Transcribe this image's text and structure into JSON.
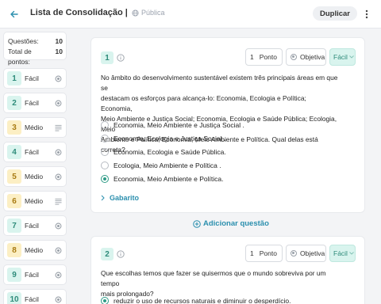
{
  "header": {
    "title": "Lista de Consolidação | Con...",
    "visibility": "Pública",
    "duplicate_label": "Duplicar"
  },
  "sidebar": {
    "stats": [
      {
        "label": "Questões:",
        "value": "10"
      },
      {
        "label": "Total de pontos:",
        "value": "10"
      }
    ],
    "items": [
      {
        "num": "1",
        "difficulty": "Fácil",
        "level": "easy",
        "type": "objective"
      },
      {
        "num": "2",
        "difficulty": "Fácil",
        "level": "easy",
        "type": "objective"
      },
      {
        "num": "3",
        "difficulty": "Médio",
        "level": "med",
        "type": "text"
      },
      {
        "num": "4",
        "difficulty": "Fácil",
        "level": "easy",
        "type": "objective"
      },
      {
        "num": "5",
        "difficulty": "Médio",
        "level": "med",
        "type": "objective"
      },
      {
        "num": "6",
        "difficulty": "Médio",
        "level": "med",
        "type": "text"
      },
      {
        "num": "7",
        "difficulty": "Fácil",
        "level": "easy",
        "type": "objective"
      },
      {
        "num": "8",
        "difficulty": "Médio",
        "level": "med",
        "type": "objective"
      },
      {
        "num": "9",
        "difficulty": "Fácil",
        "level": "easy",
        "type": "objective"
      },
      {
        "num": "10",
        "difficulty": "Fácil",
        "level": "easy",
        "type": "objective"
      }
    ]
  },
  "questions": [
    {
      "number": "1",
      "points_value": "1",
      "points_label": "Ponto",
      "type_label": "Objetiva",
      "difficulty": "Fácil",
      "prompt_lines": [
        "No âmbito do desenvolvimento sustentável existem três principais áreas em que se",
        "destacam os esforços para alcança-lo: Economia, Ecologia e Política; Economia,",
        "Meio Ambiente e Justiça Social; Economia, Ecologia e Saúde Pública; Ecologia, Meio",
        "Ambiente e Política; Economia, Meio Ambiente e Política. Qual delas está correta?"
      ],
      "options": [
        {
          "text": "Economia, Meio Ambiente e Justiça Social .",
          "selected": false
        },
        {
          "text": "Economia, Ecologia e Justiça Social .",
          "selected": false
        },
        {
          "text": "Economia, Ecologia e Saúde Pública.",
          "selected": false
        },
        {
          "text": "Ecologia, Meio Ambiente e Política .",
          "selected": false
        },
        {
          "text": "Economia, Meio Ambiente e Política.",
          "selected": true
        }
      ],
      "answer_label": "Gabarito"
    },
    {
      "number": "2",
      "points_value": "1",
      "points_label": "Ponto",
      "type_label": "Objetiva",
      "difficulty": "Fácil",
      "prompt_lines": [
        "Que escolhas temos que fazer se quisermos que o mundo sobreviva por um tempo",
        "mais prolongado?"
      ],
      "options": [
        {
          "text": "reduzir o uso de recursos naturais e diminuir o desperdício.",
          "selected": true
        }
      ]
    }
  ],
  "add_question_label": "Adicionar questão",
  "colors": {
    "accent": "#2b8fae",
    "easy": "#d9f4ee",
    "medium": "#fcefc4"
  }
}
